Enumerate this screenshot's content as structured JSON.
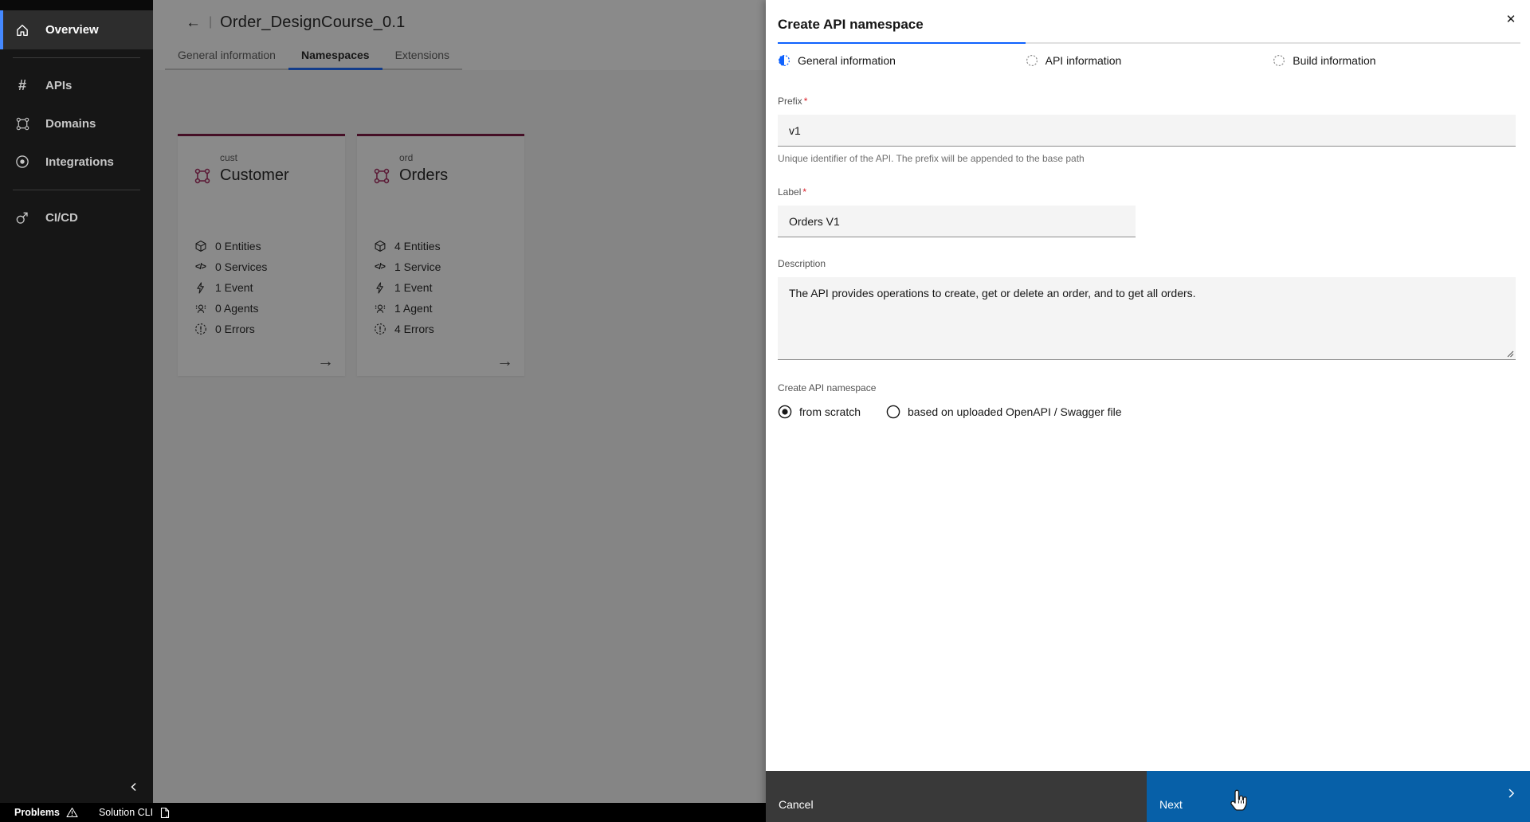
{
  "sidebar": {
    "items": [
      {
        "label": "Overview",
        "icon": "home-icon",
        "active": true
      },
      {
        "label": "APIs",
        "icon": "hash-icon",
        "active": false
      },
      {
        "label": "Domains",
        "icon": "domain-icon",
        "active": false
      },
      {
        "label": "Integrations",
        "icon": "integration-icon",
        "active": false
      },
      {
        "label": "CI/CD",
        "icon": "cicd-icon",
        "active": false
      }
    ]
  },
  "header": {
    "back_icon": "←",
    "separator": "|",
    "title": "Order_DesignCourse_0.1"
  },
  "tabs": [
    {
      "label": "General information",
      "selected": false
    },
    {
      "label": "Namespaces",
      "selected": true
    },
    {
      "label": "Extensions",
      "selected": false
    }
  ],
  "cards": [
    {
      "eyebrow": "cust",
      "title": "Customer",
      "stats": [
        {
          "icon": "cube-icon",
          "label": "0 Entities"
        },
        {
          "icon": "code-icon",
          "label": "0 Services"
        },
        {
          "icon": "bolt-icon",
          "label": "1 Event"
        },
        {
          "icon": "agent-icon",
          "label": "0 Agents"
        },
        {
          "icon": "error-icon",
          "label": "0 Errors"
        }
      ],
      "arrow": "→"
    },
    {
      "eyebrow": "ord",
      "title": "Orders",
      "stats": [
        {
          "icon": "cube-icon",
          "label": "4 Entities"
        },
        {
          "icon": "code-icon",
          "label": "1 Service"
        },
        {
          "icon": "bolt-icon",
          "label": "1 Event"
        },
        {
          "icon": "agent-icon",
          "label": "1 Agent"
        },
        {
          "icon": "error-icon",
          "label": "4 Errors"
        }
      ],
      "arrow": "→"
    }
  ],
  "panel": {
    "title": "Create API namespace",
    "close_icon": "✕",
    "steps": [
      {
        "label": "General information",
        "state": "current"
      },
      {
        "label": "API information",
        "state": "upcoming"
      },
      {
        "label": "Build information",
        "state": "upcoming"
      }
    ],
    "form": {
      "prefix": {
        "label": "Prefix",
        "required": "*",
        "value": "v1",
        "helper": "Unique identifier of the API. The prefix will be appended to the base path"
      },
      "label_field": {
        "label": "Label",
        "required": "*",
        "value": "Orders V1"
      },
      "description": {
        "label": "Description",
        "value": "The API provides operations to create, get or delete an order, and to get all orders."
      },
      "namespace_source": {
        "label": "Create API namespace",
        "options": [
          {
            "label": "from scratch",
            "selected": true
          },
          {
            "label": "based on uploaded OpenAPI / Swagger file",
            "selected": false
          }
        ]
      }
    },
    "footer": {
      "cancel_label": "Cancel",
      "next_label": "Next"
    }
  },
  "statusbar": {
    "problems_label": "Problems",
    "solution_cli_label": "Solution CLI"
  },
  "colors": {
    "accent_blue": "#0f62fe",
    "primary_button_blue": "#0760a8",
    "card_top_border": "#740937",
    "domain_icon_magenta": "#9f1853",
    "required_red": "#da1e28",
    "sidebar_bg": "#161616",
    "statusbar_bg": "#000000"
  }
}
